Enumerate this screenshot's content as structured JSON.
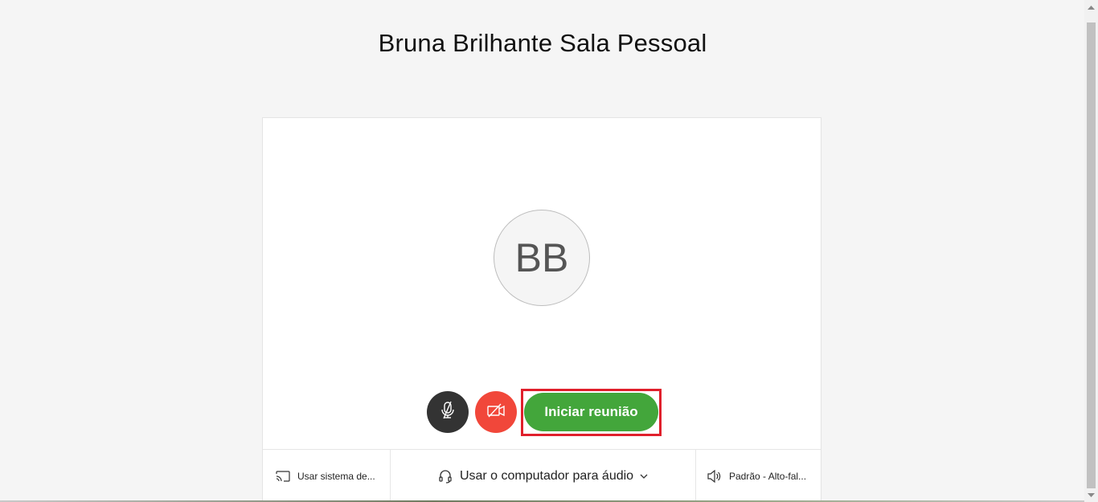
{
  "room": {
    "title": "Bruna Brilhante Sala Pessoal",
    "avatar_initials": "BB"
  },
  "controls": {
    "start_label": "Iniciar reunião",
    "mic_icon": "mic-off-icon",
    "camera_icon": "camera-off-icon",
    "mic_color": "#333333",
    "camera_color": "#f1473a",
    "start_color": "#43a63b",
    "highlight_color": "#e0202c"
  },
  "bottom_bar": {
    "share_label": "Usar sistema de...",
    "audio_label": "Usar o computador para áudio",
    "speaker_label": "Padrão - Alto-fal..."
  }
}
